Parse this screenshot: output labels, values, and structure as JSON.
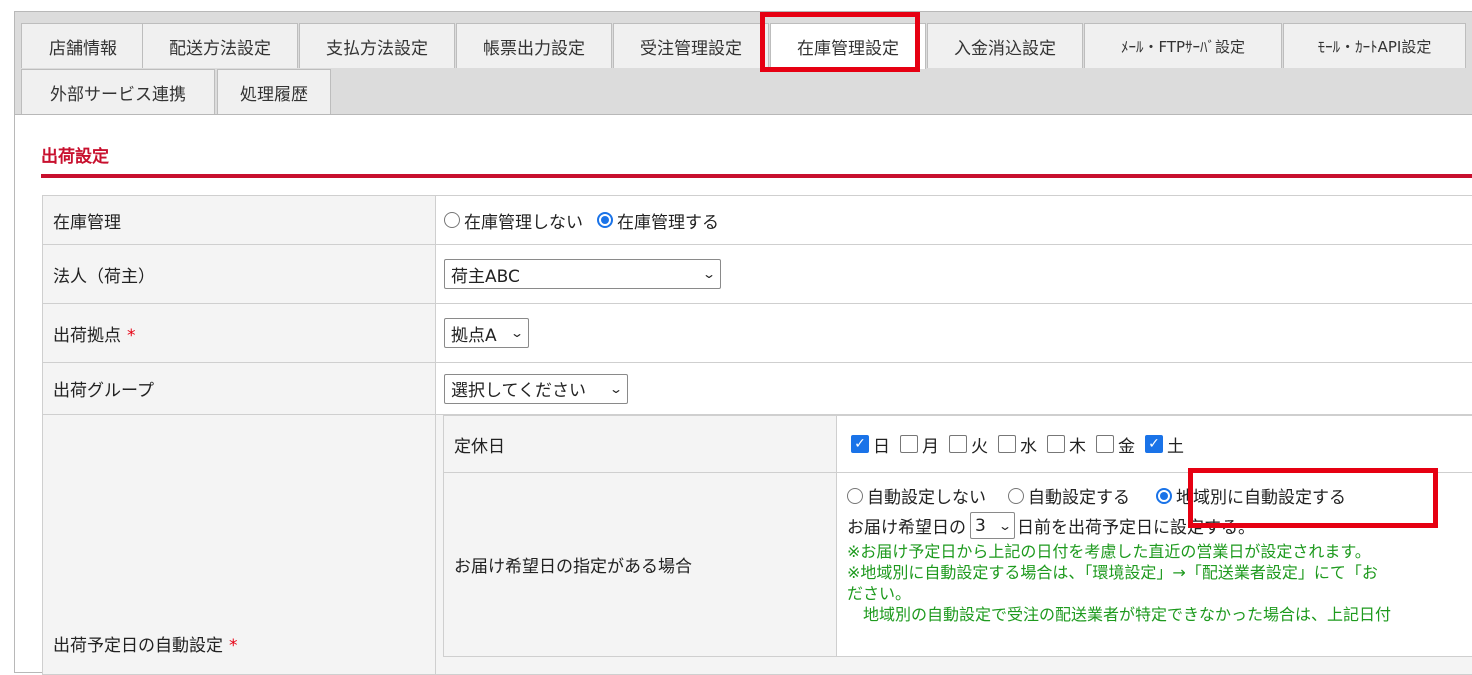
{
  "tabs": [
    {
      "label": "店舗情報"
    },
    {
      "label": "配送方法設定"
    },
    {
      "label": "支払方法設定"
    },
    {
      "label": "帳票出力設定"
    },
    {
      "label": "受注管理設定"
    },
    {
      "label": "在庫管理設定",
      "active": true
    },
    {
      "label": "入金消込設定"
    },
    {
      "label": "ﾒｰﾙ・FTPｻｰﾊﾞ設定"
    },
    {
      "label": "ﾓｰﾙ・ｶｰﾄAPI設定"
    },
    {
      "label": "外部サービス連携"
    },
    {
      "label": "処理履歴"
    }
  ],
  "section": {
    "title": "出荷設定"
  },
  "colors": {
    "accent_red": "#c8102e",
    "highlight_red": "#e60012",
    "note_green": "#1e9a1e",
    "radio_blue": "#1a73e8"
  },
  "form": {
    "inventory": {
      "label": "在庫管理",
      "options": [
        "在庫管理しない",
        "在庫管理する"
      ],
      "selected": "在庫管理する"
    },
    "corp": {
      "label": "法人（荷主）",
      "value": "荷主ABC"
    },
    "base": {
      "label": "出荷拠点",
      "required_mark": "*",
      "value": "拠点A"
    },
    "group": {
      "label": "出荷グループ",
      "value": "選択してください"
    },
    "auto": {
      "label": "出荷予定日の自動設定",
      "required_mark": "*",
      "holidays": {
        "label": "定休日",
        "days": [
          {
            "label": "日",
            "checked": true
          },
          {
            "label": "月",
            "checked": false
          },
          {
            "label": "火",
            "checked": false
          },
          {
            "label": "水",
            "checked": false
          },
          {
            "label": "木",
            "checked": false
          },
          {
            "label": "金",
            "checked": false
          },
          {
            "label": "土",
            "checked": true
          }
        ]
      },
      "specified": {
        "label": "お届け希望日の指定がある場合",
        "options": [
          "自動設定しない",
          "自動設定する",
          "地域別に自動設定する"
        ],
        "selected": "地域別に自動設定する",
        "days_prefix": "お届け希望日の",
        "days_value": "3",
        "days_suffix": "日前を出荷予定日に設定する。",
        "notes": [
          "※お届け予定日から上記の日付を考慮した直近の営業日が設定されます。",
          "※地域別に自動設定する場合は、「環境設定」→「配送業者設定」にて「お",
          "ださい。",
          "　地域別の自動設定で受注の配送業者が特定できなかった場合は、上記日付"
        ]
      }
    }
  }
}
